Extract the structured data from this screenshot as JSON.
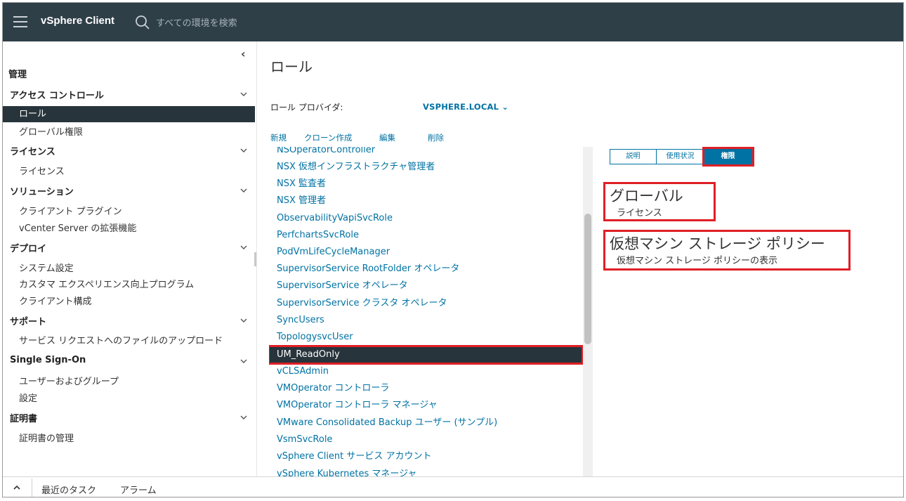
{
  "header": {
    "app_title": "vSphere Client",
    "search_placeholder": "すべての環境を検索"
  },
  "nav": {
    "root_label": "管理",
    "groups": [
      {
        "label": "アクセス コントロール",
        "items": [
          "ロール",
          "グローバル権限"
        ]
      },
      {
        "label": "ライセンス",
        "items": [
          "ライセンス"
        ]
      },
      {
        "label": "ソリューション",
        "items": [
          "クライアント プラグイン",
          "vCenter Server の拡張機能"
        ]
      },
      {
        "label": "デプロイ",
        "items": [
          "システム設定",
          "カスタマ エクスペリエンス向上プログラム",
          "クライアント構成"
        ]
      },
      {
        "label": "サポート",
        "items": [
          "サービス リクエストへのファイルのアップロード"
        ]
      },
      {
        "label": "Single Sign-On",
        "items": [
          "ユーザーおよびグループ",
          "設定"
        ]
      },
      {
        "label": "証明書",
        "items": [
          "証明書の管理"
        ]
      }
    ],
    "selected_item": "ロール"
  },
  "main": {
    "title": "ロール",
    "provider_label": "ロール プロバイダ:",
    "provider_value": "VSPHERE.LOCAL",
    "actions": [
      "新規",
      "クローン作成",
      "編集",
      "削除"
    ],
    "roles": [
      "NSOperatorController",
      "NSX 仮想インフラストラクチャ管理者",
      "NSX 監査者",
      "NSX 管理者",
      "ObservabilityVapiSvcRole",
      "PerfchartsSvcRole",
      "PodVmLifeCycleManager",
      "SupervisorService RootFolder オペレータ",
      "SupervisorService オペレータ",
      "SupervisorService クラスタ オペレータ",
      "SyncUsers",
      "TopologysvcUser",
      "UM_ReadOnly",
      "vCLSAdmin",
      "VMOperator コントローラ",
      "VMOperator コントローラ マネージャ",
      "VMware Consolidated Backup ユーザー (サンプル)",
      "VsmSvcRole",
      "vSphere Client サービス アカウント",
      "vSphere Kubernetes マネージャ"
    ],
    "selected_role": "UM_ReadOnly",
    "detail_tabs": [
      "説明",
      "使用状況",
      "権限"
    ],
    "active_tab": "権限",
    "privileges": [
      {
        "title": "グローバル",
        "items": [
          "ライセンス"
        ]
      },
      {
        "title": "仮想マシン ストレージ ポリシー",
        "items": [
          "仮想マシン ストレージ ポリシーの表示"
        ]
      }
    ]
  },
  "bottom": {
    "recent_tasks": "最近のタスク",
    "alarms": "アラーム"
  },
  "colors": {
    "header_bg": "#2f3f48",
    "selected_bg": "#27343b",
    "link": "#0072a3",
    "highlight": "#e01f26"
  }
}
